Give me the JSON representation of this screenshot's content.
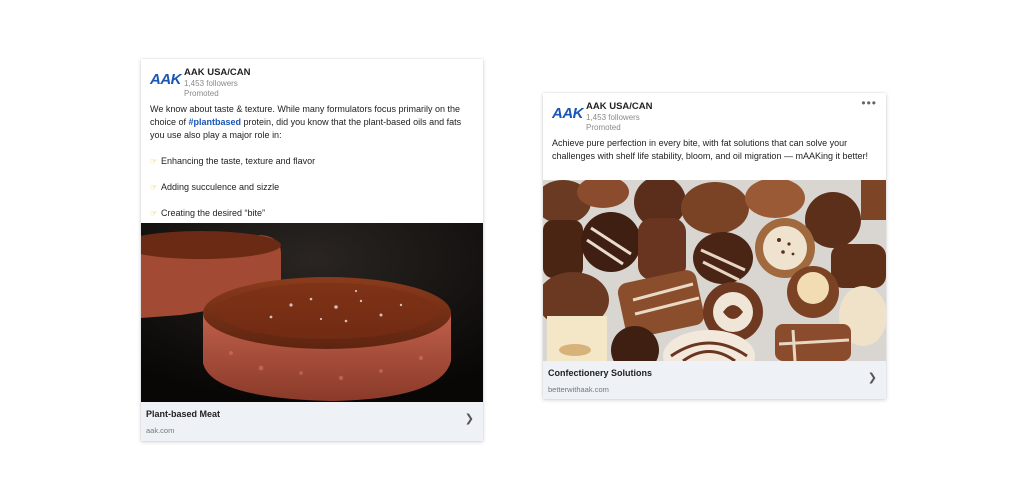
{
  "posts": [
    {
      "company": "AAK USA/CAN",
      "logo_text": "AAK",
      "followers": "1,453 followers",
      "promoted": "Promoted",
      "intro_before_tag": "We know about taste & texture. While many formulators focus primarily on the choice of ",
      "hashtag": "#plantbased",
      "intro_after_tag": " protein, did you know that the plant-based oils and fats you use also play a major role in:",
      "bullets": [
        "Enhancing the taste, texture and flavor",
        "Adding succulence and sizzle",
        "Creating the desired “bite”"
      ],
      "bullet_icon": "pointing-hand-icon",
      "image": "plant-based-burger-patty-photo",
      "link_title": "Plant-based Meat",
      "link_domain": "aak.com"
    },
    {
      "company": "AAK USA/CAN",
      "logo_text": "AAK",
      "followers": "1,453 followers",
      "promoted": "Promoted",
      "more_icon": "•••",
      "text": "Achieve pure perfection in every bite, with fat solutions that can solve your challenges with shelf life stability, bloom, and oil migration — mAAKing it better!",
      "image": "assorted-chocolates-photo",
      "link_title": "Confectionery Solutions",
      "link_domain": "betterwithaak.com"
    }
  ],
  "chevron": "❯",
  "colors": {
    "brand": "#1a56b5",
    "link_bar": "#eef2f6"
  }
}
